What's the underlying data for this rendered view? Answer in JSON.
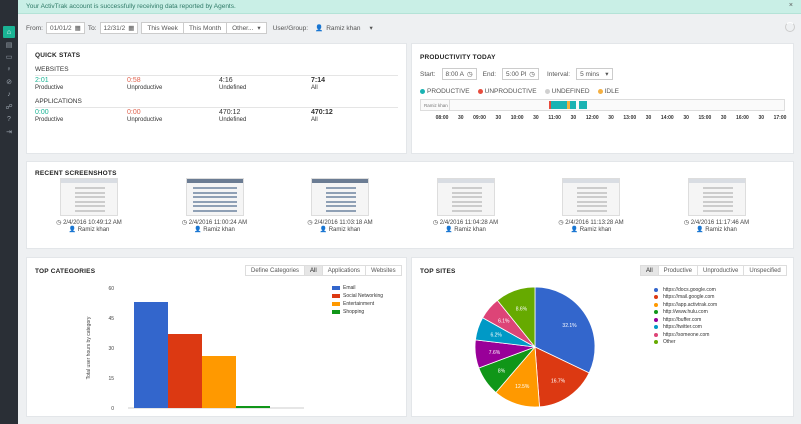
{
  "banner": {
    "message": "Your ActivTrak account is successfully receiving data reported by Agents.",
    "close": "×"
  },
  "sidebar": {
    "icons": [
      "home-icon",
      "document-icon",
      "monitor-icon",
      "pin-icon",
      "block-icon",
      "bell-icon",
      "users-icon",
      "help-icon",
      "logout-icon"
    ]
  },
  "filter": {
    "from_label": "From:",
    "from_value": "01/01/2",
    "to_label": "To:",
    "to_value": "12/31/2",
    "this_week": "This Week",
    "this_month": "This Month",
    "other": "Other...",
    "user_group_label": "User/Group:",
    "user_value": "Ramiz khan"
  },
  "quick_stats": {
    "title": "QUICK STATS",
    "websites_label": "WEBSITES",
    "applications_label": "APPLICATIONS",
    "websites": [
      {
        "value": "2:01",
        "label": "Productive"
      },
      {
        "value": "0:58",
        "label": "Unproductive"
      },
      {
        "value": "4:16",
        "label": "Undefined"
      },
      {
        "value": "7:14",
        "label": "All"
      }
    ],
    "applications": [
      {
        "value": "0:00",
        "label": "Productive"
      },
      {
        "value": "0:00",
        "label": "Unproductive"
      },
      {
        "value": "470:12",
        "label": "Undefined"
      },
      {
        "value": "470:12",
        "label": "All"
      }
    ]
  },
  "productivity": {
    "title": "PRODUCTIVITY TODAY",
    "start_label": "Start:",
    "start_value": "8:00 A",
    "end_label": "End:",
    "end_value": "5:00 Pl",
    "interval_label": "Interval:",
    "interval_value": "5 mins",
    "legend": [
      {
        "label": "PRODUCTIVE",
        "color": "#1ab3b3"
      },
      {
        "label": "UNPRODUCTIVE",
        "color": "#e84c3d"
      },
      {
        "label": "UNDEFINED",
        "color": "#d0d0d0"
      },
      {
        "label": "IDLE",
        "color": "#f5b041"
      }
    ],
    "row_label": "Ramiz khan",
    "ticks": [
      "08:00",
      "30",
      "09:00",
      "30",
      "10:00",
      "30",
      "11:00",
      "30",
      "12:00",
      "30",
      "13:00",
      "30",
      "14:00",
      "30",
      "15:00",
      "30",
      "16:00",
      "30",
      "17:00"
    ]
  },
  "screenshots": {
    "title": "RECENT SCREENSHOTS",
    "items": [
      {
        "time": "2/4/2016 10:49:12 AM",
        "user": "Ramiz khan"
      },
      {
        "time": "2/4/2016 11:00:24 AM",
        "user": "Ramiz khan"
      },
      {
        "time": "2/4/2016 11:03:18 AM",
        "user": "Ramiz khan"
      },
      {
        "time": "2/4/2016 11:04:28 AM",
        "user": "Ramiz khan"
      },
      {
        "time": "2/4/2016 11:13:28 AM",
        "user": "Ramiz khan"
      },
      {
        "time": "2/4/2016 11:17:46 AM",
        "user": "Ramiz khan"
      }
    ]
  },
  "top_categories": {
    "title": "TOP CATEGORIES",
    "tabs": [
      "Define Categories",
      "All",
      "Applications",
      "Websites"
    ],
    "active_tab": "All"
  },
  "top_sites": {
    "title": "TOP SITES",
    "tabs": [
      "All",
      "Productive",
      "Unproductive",
      "Unspecified"
    ],
    "active_tab": "All"
  },
  "chart_data": [
    {
      "type": "bar",
      "ylabel": "Total user hours by category",
      "ylim": [
        0,
        60
      ],
      "yticks": [
        0,
        15,
        30,
        45,
        60
      ],
      "series": [
        {
          "name": "Email",
          "color": "#3366cc",
          "value": 53
        },
        {
          "name": "Social Networking",
          "color": "#dc3912",
          "value": 37
        },
        {
          "name": "Entertainment",
          "color": "#ff9900",
          "value": 26
        },
        {
          "name": "Shopping",
          "color": "#109618",
          "value": 1
        }
      ],
      "legend_position": "top-right",
      "grid": false
    },
    {
      "type": "pie",
      "slices": [
        {
          "name": "https://docs.google.com",
          "value": 32.1,
          "label": "32.1%",
          "color": "#3366cc"
        },
        {
          "name": "https://mail.google.com",
          "value": 16.7,
          "label": "16.7%",
          "color": "#dc3912"
        },
        {
          "name": "https://app.activtrak.com",
          "value": 12.5,
          "label": "12.5%",
          "color": "#ff9900"
        },
        {
          "name": "http://www.hulu.com",
          "value": 8.0,
          "label": "8%",
          "color": "#109618"
        },
        {
          "name": "https://buffer.com",
          "value": 7.6,
          "label": "7.6%",
          "color": "#990099"
        },
        {
          "name": "https://twitter.com",
          "value": 6.2,
          "label": "6.2%",
          "color": "#0099c6"
        },
        {
          "name": "https://someone.com",
          "value": 6.1,
          "label": "6.1%",
          "color": "#dd4477"
        },
        {
          "name": "Other",
          "value": 10.8,
          "label": "8.6%",
          "color": "#66aa00"
        }
      ],
      "legend_position": "right"
    }
  ]
}
